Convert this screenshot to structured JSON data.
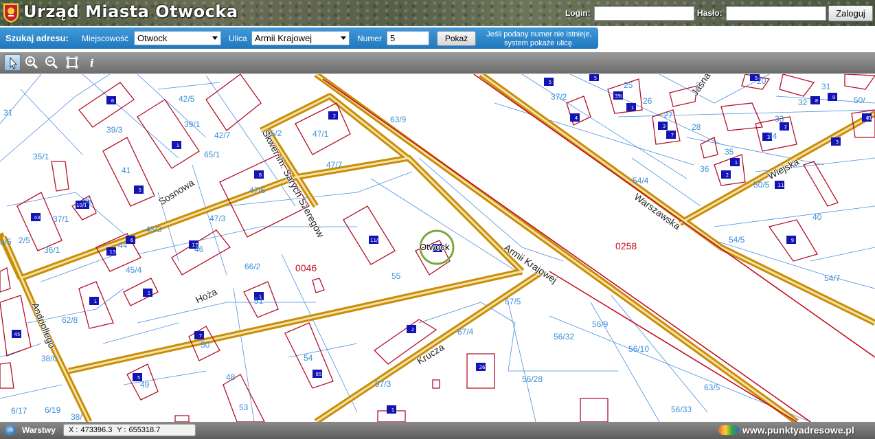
{
  "header": {
    "city_title": "Urząd Miasta Otwocka",
    "login_label": "Login:",
    "login_value": "",
    "password_label": "Hasło:",
    "password_value": "",
    "login_button": "Zaloguj"
  },
  "search": {
    "title": "Szukaj adresu:",
    "town_label": "Miejscowość",
    "town_value": "Otwock",
    "street_label": "Ulica",
    "street_value": "Armii Krajowej",
    "number_label": "Numer",
    "number_value": "5",
    "show_button": "Pokaż",
    "hint_line1": "Jeśli podany numer nie istnieje,",
    "hint_line2": "system pokaże ulicę."
  },
  "toolbar": {
    "tools": [
      "pointer-icon",
      "zoom-in-icon",
      "zoom-out-icon",
      "full-extent-icon",
      "info-icon"
    ]
  },
  "map": {
    "precincts": [
      "0046",
      "0258"
    ],
    "marker_label": "Otwock",
    "streets": [
      "Sosnowa",
      "Skwer im. Sarych Szeregów",
      "Hoża",
      "Andriollego",
      "Kruczа",
      "Armii Krajowej",
      "Warszawska",
      "Wiejska",
      "Jasna"
    ],
    "parcels": [
      "31",
      "42/5",
      "39/3",
      "39/1",
      "35/1",
      "41",
      "42/7",
      "65/2",
      "65/1",
      "47/1",
      "47/7",
      "47/6",
      "37/1",
      "38",
      "63/9",
      "2/5",
      "36/1",
      "45/3",
      "47/3",
      "45/4",
      "66/2",
      "0046",
      "62/8",
      "51",
      "38/0",
      "50",
      "54",
      "49",
      "48",
      "53",
      "6/17",
      "6/19",
      "38/",
      "55",
      "56/32",
      "56/9",
      "56/10",
      "56/28",
      "63/5",
      "56/33",
      "67/5",
      "67/4",
      "57/3",
      "37/2",
      "25",
      "26",
      "27",
      "28",
      "32",
      "34",
      "33",
      "35",
      "36",
      "30",
      "20",
      "31",
      "50/",
      "40",
      "54/4",
      "50/5",
      "54/5",
      "54/7",
      "0258",
      "a/5",
      "44",
      "46"
    ],
    "buildings": [
      "6",
      "1",
      "2",
      "8",
      "5",
      "43",
      "10/12",
      "13",
      "6",
      "17",
      "1",
      "1",
      "45",
      "1",
      "11/3",
      "5",
      "2",
      "7",
      "85",
      "5",
      "26",
      "1",
      "5",
      "4",
      "39/1",
      "1",
      "5",
      "3",
      "7",
      "5",
      "2",
      "3",
      "1",
      "2",
      "3",
      "8",
      "9",
      "11",
      "9",
      "2",
      "41",
      "1",
      "5"
    ]
  },
  "status": {
    "layers_icon_label": "ok",
    "layers_label": "Warstwy",
    "x_label": "X :",
    "x_value": "473396.3",
    "y_label": "Y :",
    "y_value": "655318.7",
    "brand": "www.punktyadresowe.pl"
  }
}
